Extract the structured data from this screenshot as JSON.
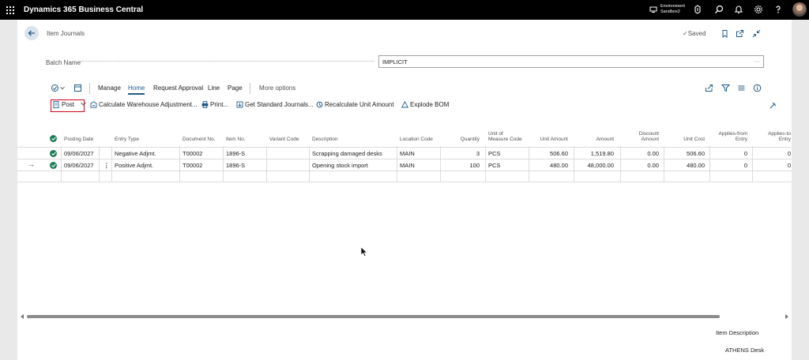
{
  "topbar": {
    "app_title": "Dynamics 365 Business Central",
    "environment_line1": "Environment",
    "environment_line2": "Sandbox2"
  },
  "page": {
    "breadcrumb": "Item Journals",
    "saved_label": "Saved",
    "batch_name_label": "Batch Name",
    "batch_name_value": "IMPLICIT",
    "batch_name_ellipsis": "···"
  },
  "menu": {
    "manage": "Manage",
    "home": "Home",
    "request_approval": "Request Approval",
    "line": "Line",
    "page": "Page",
    "more_options": "More options"
  },
  "actions": {
    "post": "Post",
    "calc_warehouse": "Calculate Warehouse Adjustment...",
    "print": "Print...",
    "get_standard": "Get Standard Journals...",
    "recalc_unit_amount": "Recalculate Unit Amount",
    "explode_bom": "Explode BOM"
  },
  "grid": {
    "headers": {
      "posting_date": "Posting Date",
      "entry_type": "Entry Type",
      "document_no": "Document No.",
      "item_no": "Item No.",
      "variant_code": "Variant Code",
      "description": "Description",
      "location_code": "Location Code",
      "quantity": "Quantity",
      "uom_line1": "Unit of",
      "uom_line2": "Measure Code",
      "unit_amount": "Unit Amount",
      "amount": "Amount",
      "discount_line1": "Discount",
      "discount_line2": "Amount",
      "unit_cost": "Unit Cost",
      "applies_from_line1": "Applies-from",
      "applies_from_line2": "Entry",
      "applies_to_line1": "Applies-to",
      "applies_to_line2": "Entry"
    },
    "rows": [
      {
        "posting_date": "09/06/2027",
        "entry_type": "Negative Adjmt.",
        "document_no": "T00002",
        "item_no": "1896-S",
        "variant_code": "",
        "description": "Scrapping damaged desks",
        "location_code": "MAIN",
        "quantity": "3",
        "uom": "PCS",
        "unit_amount": "506.60",
        "amount": "1,519.80",
        "discount_amount": "0.00",
        "unit_cost": "506.60",
        "applies_from": "0",
        "applies_to": "0"
      },
      {
        "posting_date": "09/06/2027",
        "entry_type": "Positive Adjmt.",
        "document_no": "T00002",
        "item_no": "1896-S",
        "variant_code": "",
        "description": "Opening stock import",
        "location_code": "MAIN",
        "quantity": "100",
        "uom": "PCS",
        "unit_amount": "480.00",
        "amount": "48,000.00",
        "discount_amount": "0.00",
        "unit_cost": "480.00",
        "applies_from": "0",
        "applies_to": "0"
      }
    ],
    "row_arrow": "→",
    "row_menu": "⋮"
  },
  "factbox": {
    "item_description_label": "Item Description",
    "item_description_value": "ATHENS Desk"
  },
  "colors": {
    "topbar": "#000000",
    "accent": "#1f5c8b",
    "status_green": "#1e7d55",
    "post_highlight": "#d0021b"
  }
}
